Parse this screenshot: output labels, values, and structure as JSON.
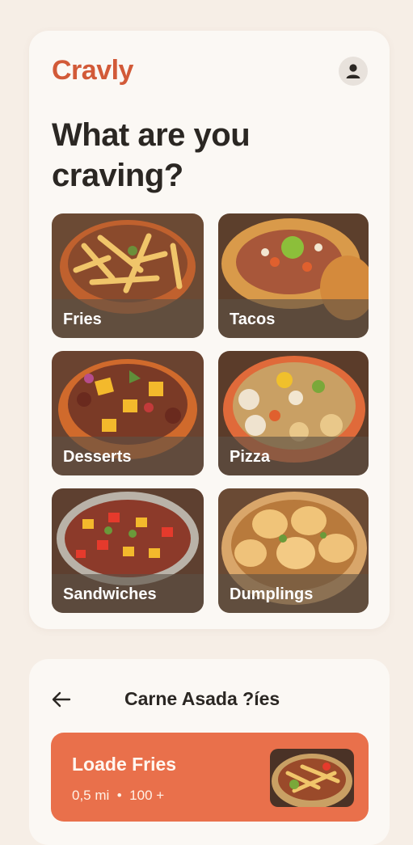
{
  "app": {
    "brand": "Cravly"
  },
  "header": {
    "avatar_icon": "user-icon"
  },
  "hero": {
    "headline": "What are you craving?"
  },
  "categories": [
    {
      "label": "Fries"
    },
    {
      "label": "Tacos"
    },
    {
      "label": "Desserts"
    },
    {
      "label": "Pizza"
    },
    {
      "label": "Sandwiches"
    },
    {
      "label": "Dumplings"
    }
  ],
  "sheet": {
    "back_icon": "arrow-left-icon",
    "title": "Carne Asada ?íes",
    "result": {
      "name": "Loade Fries",
      "distance": "0,5 mi",
      "separator": "•",
      "count": "100 +"
    }
  },
  "colors": {
    "brand": "#d25a38",
    "accent_card": "#e9704b",
    "background": "#f6eee6"
  }
}
